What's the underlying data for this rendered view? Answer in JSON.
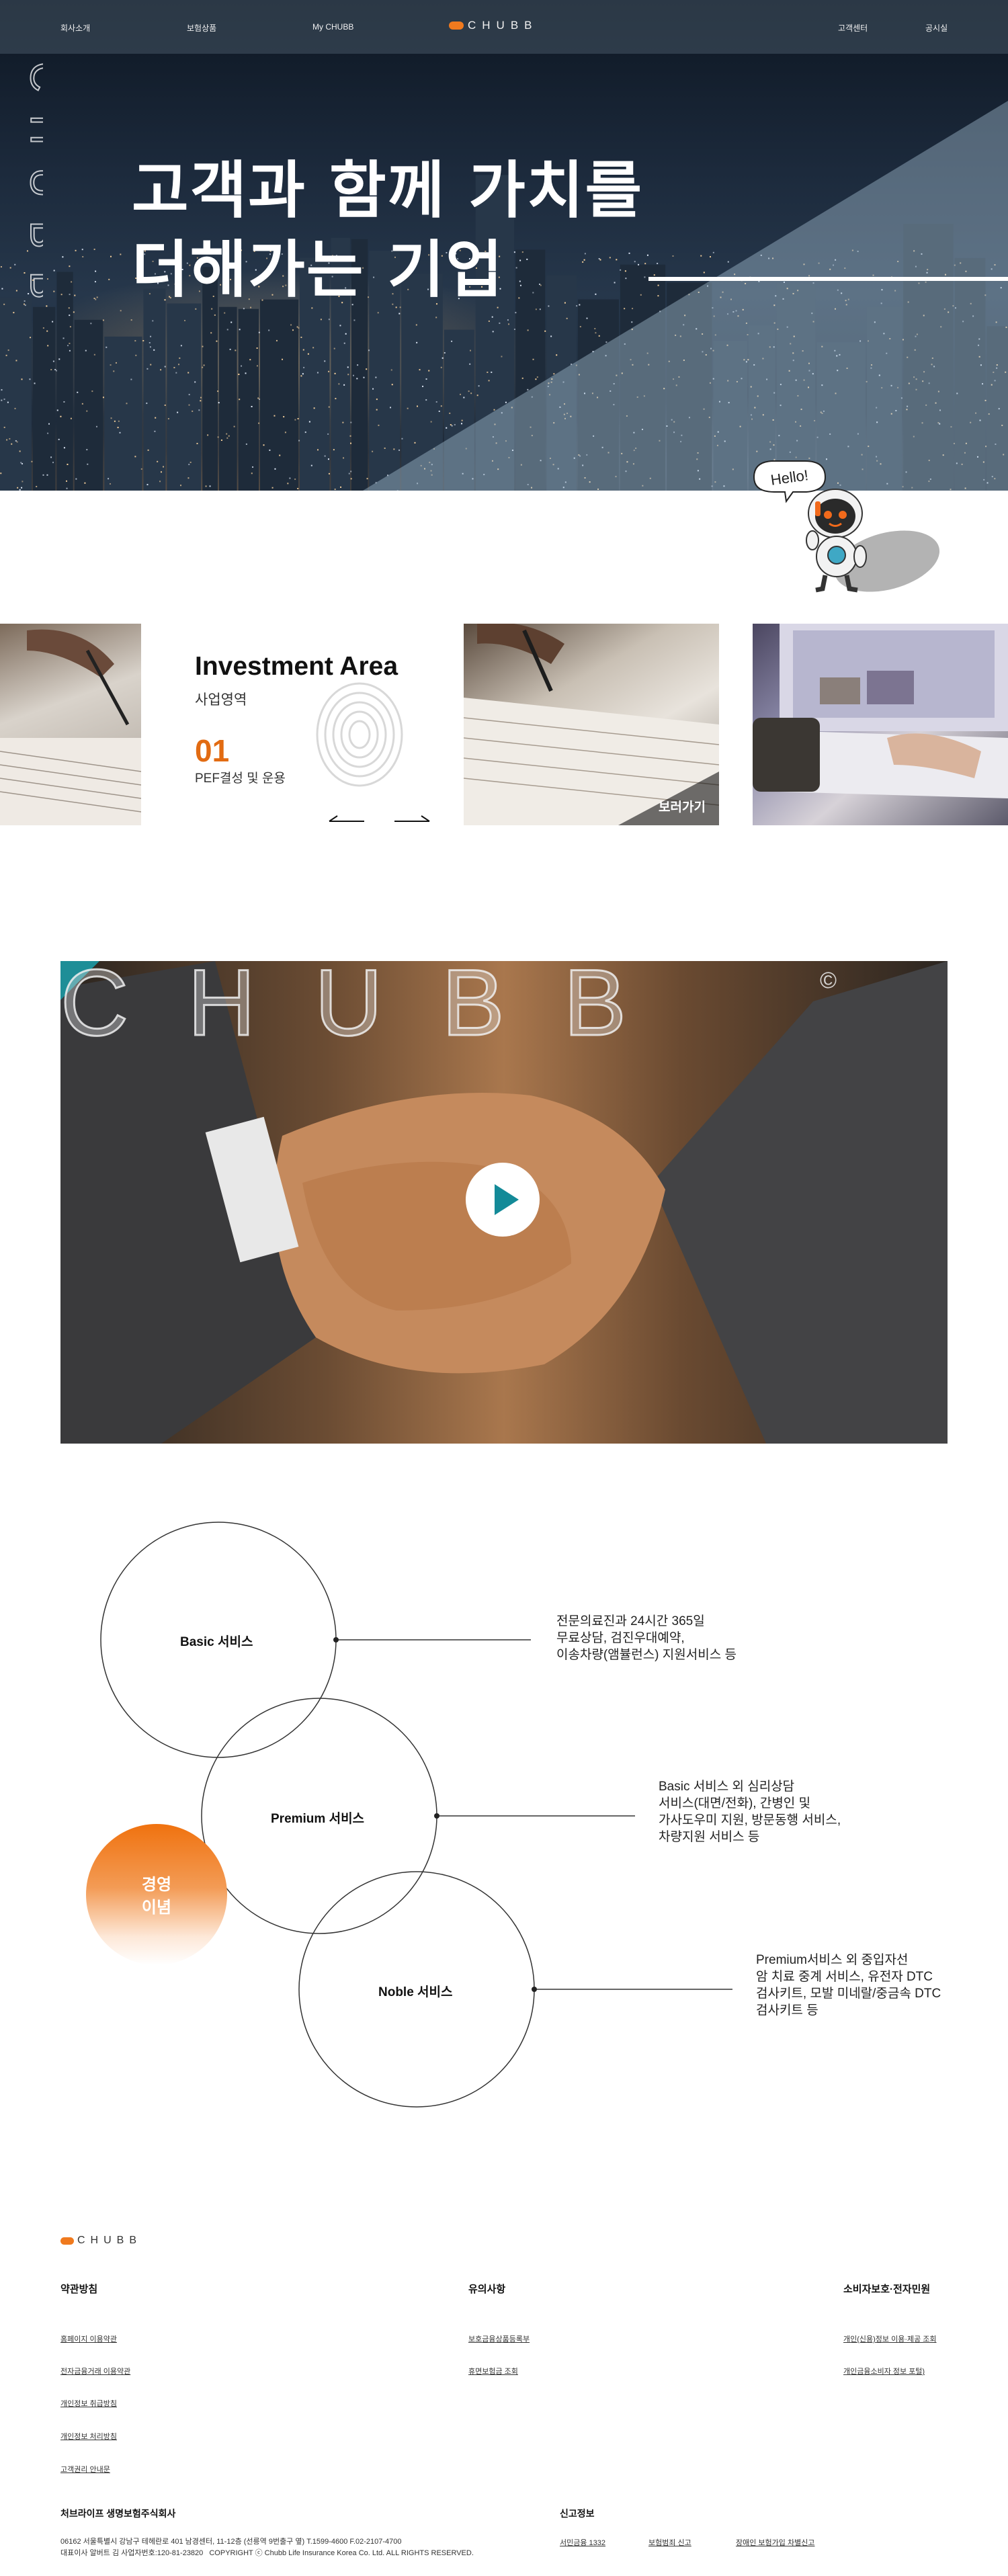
{
  "nav": {
    "left_items": [
      "회사소개",
      "보험상품",
      "My CHUBB"
    ],
    "right_items": [
      "고객센터",
      "공시실"
    ],
    "logo_text": "CHUBB",
    "brand_color": "#f07a1e"
  },
  "hero": {
    "title_line1": "고객과 함께 가치를",
    "title_line2": "더해가는 기업",
    "vertical_text": "CHUBB"
  },
  "mascot": {
    "bubble": "Hello!"
  },
  "investment": {
    "title": "Investment Area",
    "subtitle": "사업영역",
    "number": "01",
    "description": "PEF결성 및 운용",
    "see_more": "보러가기",
    "accent_color": "#e26b12"
  },
  "video": {
    "logo_text": "CHUBB",
    "play_icon": "play-icon",
    "accent_color": "#138a98"
  },
  "services": {
    "philosophy_line1": "경영",
    "philosophy_line2": "이념",
    "items": [
      {
        "name": "Basic 서비스",
        "desc": [
          "전문의료진과 24시간 365일",
          "무료상담, 검진우대예약,",
          "이송차량(앰뷸런스) 지원서비스 등"
        ]
      },
      {
        "name": "Premium 서비스",
        "desc": [
          "Basic 서비스 외 심리상담",
          "서비스(대면/전화), 간병인 및",
          "가사도우미 지원, 방문동행 서비스,",
          "차량지원 서비스 등"
        ]
      },
      {
        "name": "Noble 서비스",
        "desc": [
          "Premium서비스 외 중입자선",
          "암 치료 중계 서비스, 유전자 DTC",
          "검사키트, 모발 미네랄/중금속 DTC",
          "검사키트 등"
        ]
      }
    ]
  },
  "footer": {
    "logo_text": "CHUBB",
    "col1": {
      "heading": "약관방침",
      "links": [
        "홈페이지 이용약관",
        "전자금융거래 이용약관",
        "개인정보 취급방침",
        "개인정보 처리방침",
        "고객권리 안내문"
      ]
    },
    "col2": {
      "heading": "유의사항",
      "links": [
        "보호금융상품등록부",
        "휴면보험금 조회"
      ]
    },
    "col3": {
      "heading": "소비자보호·전자민원",
      "links": [
        "개인(신용)정보 이용·제공 조회",
        "개인금융소비자 정보 포털)"
      ]
    },
    "company": "처브라이프 생명보험주식회사",
    "address1": "06162 서울특별시 강남구 테헤란로 401 남경센터, 11-12층 (선릉역 9번출구 옆) T.1599-4600 F.02-2107-4700",
    "address2": "대표이사 알버트 김 사업자번호:120-81-23820",
    "copyright": "COPYRIGHT ⓒ Chubb Life Insurance Korea Co. Ltd. ALL RIGHTS RESERVED.",
    "info_heading": "신고정보",
    "info_links": [
      "서민금융 1332",
      "보험범죄 신고",
      "장애인 보험가입 차별신고"
    ]
  }
}
